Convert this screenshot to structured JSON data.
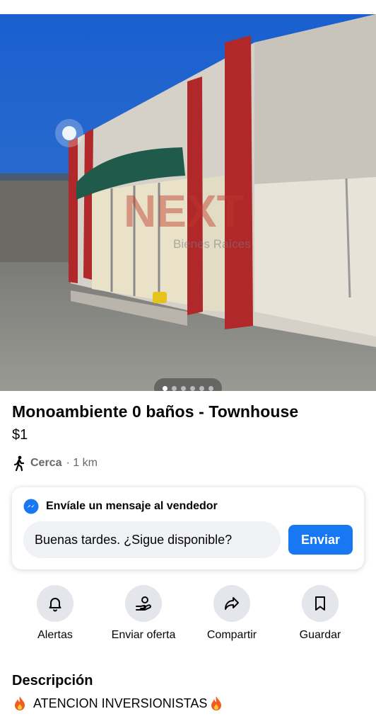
{
  "listing": {
    "title": "Monoambiente 0 baños - Townhouse",
    "price": "$1",
    "location_label": "Cerca",
    "location_distance": "· 1 km",
    "photo_watermark_logo": "NEXT",
    "photo_watermark_sub": "Bienes Raíces",
    "photo_count": 6,
    "photo_index": 1
  },
  "message": {
    "header": "Envíale un mensaje al vendedor",
    "input_value": "Buenas tardes. ¿Sigue disponible?",
    "send_label": "Enviar"
  },
  "actions": [
    {
      "label": "Alertas",
      "icon": "bell-icon"
    },
    {
      "label": "Enviar oferta",
      "icon": "offer-icon"
    },
    {
      "label": "Compartir",
      "icon": "share-icon"
    },
    {
      "label": "Guardar",
      "icon": "bookmark-icon"
    }
  ],
  "description": {
    "title": "Descripción",
    "text": "ATENCION INVERSIONISTAS"
  },
  "colors": {
    "accent": "#1877f2",
    "secondary_text": "#65676b",
    "chip_bg": "#e4e6eb"
  }
}
